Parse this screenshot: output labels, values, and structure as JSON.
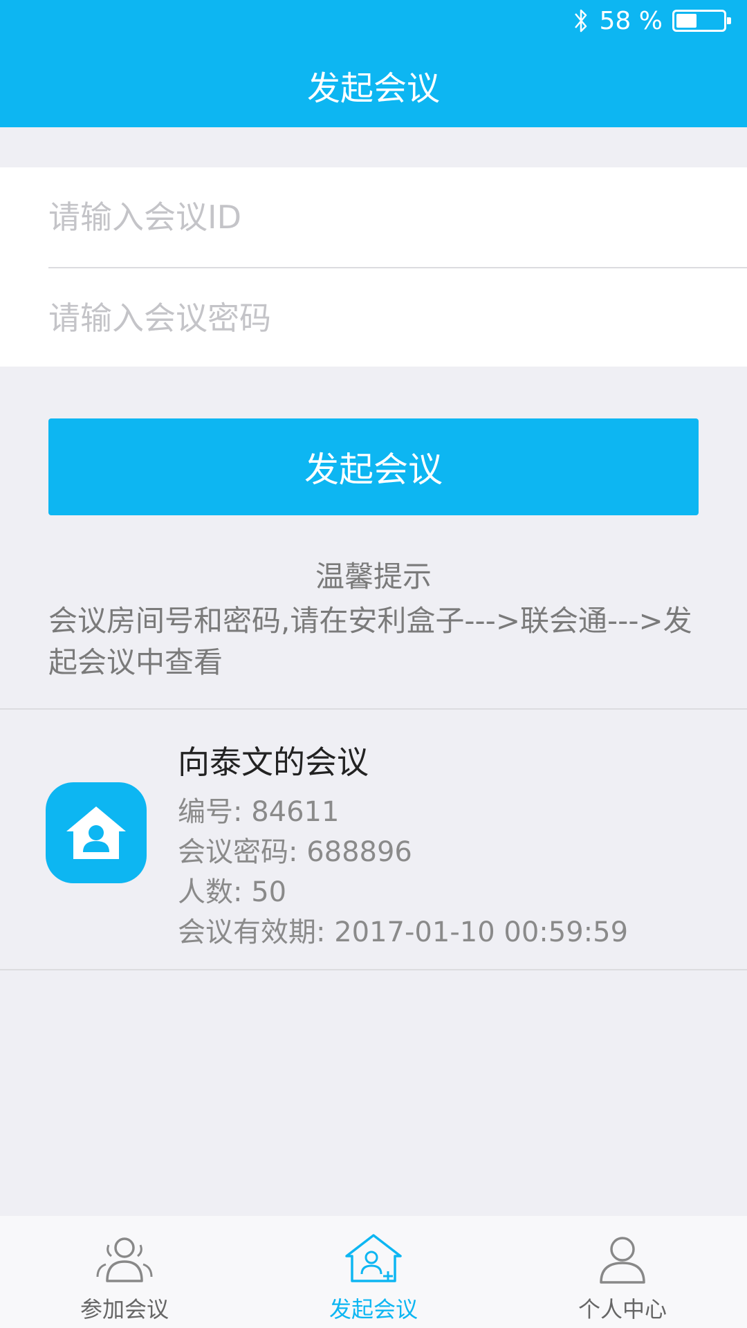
{
  "status_bar": {
    "battery_text": "58 %",
    "battery_level": 0.58
  },
  "header": {
    "title": "发起会议"
  },
  "form": {
    "meeting_id": {
      "value": "",
      "placeholder": "请输入会议ID"
    },
    "meeting_password": {
      "value": "",
      "placeholder": "请输入会议密码"
    }
  },
  "start_button": {
    "label": "发起会议"
  },
  "tips": {
    "title": "温馨提示",
    "body": "会议房间号和密码,请在安利盒子--->联会通--->发起会议中查看"
  },
  "meeting": {
    "title": "向泰文的会议",
    "number": "编号: 84611",
    "password": "会议密码: 688896",
    "participants": "人数: 50",
    "validity": "会议有效期: 2017-01-10    00:59:59",
    "icon": "home-user-icon"
  },
  "tabbar": {
    "tabs": [
      {
        "label": "参加会议",
        "icon": "group-icon",
        "active": false
      },
      {
        "label": "发起会议",
        "icon": "home-add-icon",
        "active": true
      },
      {
        "label": "个人中心",
        "icon": "person-icon",
        "active": false
      }
    ]
  },
  "colors": {
    "primary": "#0db6f2",
    "background": "#efeff4",
    "tab_inactive": "#888888"
  }
}
